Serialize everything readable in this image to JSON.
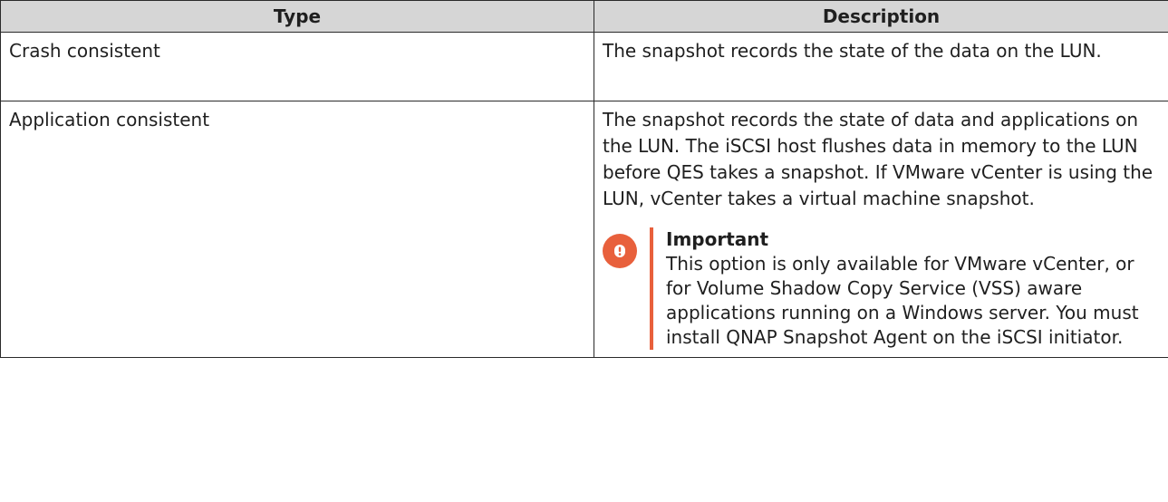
{
  "table": {
    "headers": {
      "type": "Type",
      "description": "Description"
    },
    "rows": [
      {
        "type": "Crash consistent",
        "description": "The snapshot records the state of the data on the LUN."
      },
      {
        "type": "Application consistent",
        "description": "The snapshot records the state of data and applications on the LUN. The iSCSI host flushes data in memory to the LUN before QES takes a snapshot. If VMware vCenter is using the LUN, vCenter takes a virtual machine snapshot.",
        "note": {
          "icon": "important-icon",
          "title": "Important",
          "text": "This option is only available for VMware vCenter, or for Volume Shadow Copy Service (VSS) aware applications running on a Windows server. You must install QNAP Snapshot Agent on the iSCSI initiator."
        }
      }
    ]
  },
  "colors": {
    "header_bg": "#d6d6d6",
    "border": "#2a2a2a",
    "accent": "#e8603c"
  }
}
